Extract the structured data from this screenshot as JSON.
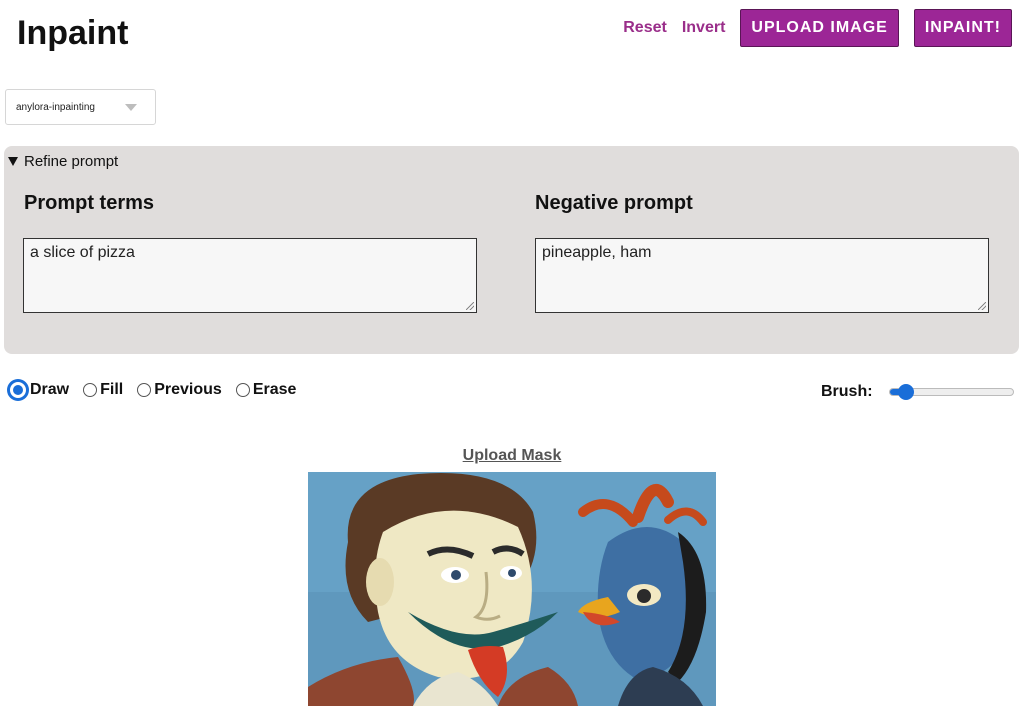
{
  "header": {
    "title": "Inpaint",
    "reset_label": "Reset",
    "invert_label": "Invert",
    "upload_image_label": "UPLOAD IMAGE",
    "inpaint_label": "INPAINT!"
  },
  "model": {
    "selected": "anylora-inpainting"
  },
  "refine": {
    "summary": "Refine prompt",
    "prompt_heading": "Prompt terms",
    "prompt_value": "a slice of pizza",
    "negative_heading": "Negative prompt",
    "negative_value": "pineapple, ham"
  },
  "modes": {
    "selected": "Draw",
    "items": [
      "Draw",
      "Fill",
      "Previous",
      "Erase"
    ]
  },
  "brush": {
    "label": "Brush:",
    "level_fraction": 0.13
  },
  "mask": {
    "upload_label": "Upload Mask"
  },
  "colors": {
    "accent": "#9c2696",
    "link": "#9a2e8a",
    "panel_bg": "#e0dddc",
    "control_blue": "#1a6ed8"
  },
  "icons": {
    "refine_toggle": "triangle-down-icon",
    "select_caret": "chevron-down-icon"
  }
}
